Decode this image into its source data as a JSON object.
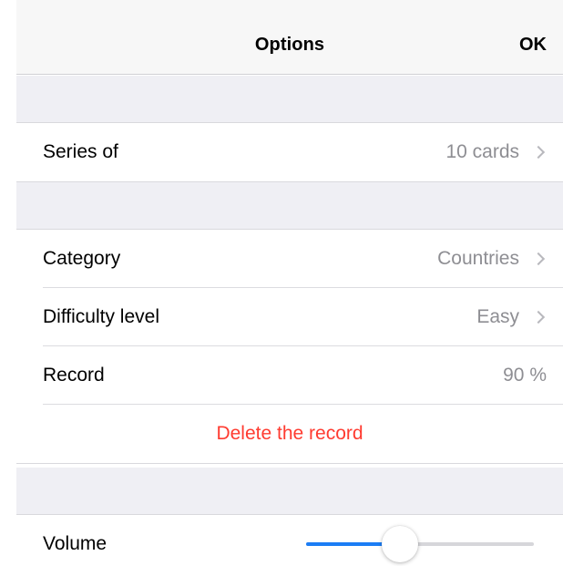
{
  "navbar": {
    "title": "Options",
    "ok_label": "OK"
  },
  "series": {
    "label": "Series of",
    "value": "10 cards"
  },
  "game": {
    "category": {
      "label": "Category",
      "value": "Countries"
    },
    "difficulty": {
      "label": "Difficulty level",
      "value": "Easy"
    },
    "record": {
      "label": "Record",
      "value": "90 %"
    },
    "delete_label": "Delete the record"
  },
  "sound": {
    "volume_label": "Volume",
    "volume_level": 0.41
  },
  "colors": {
    "accent": "#1b7df5",
    "destructive": "#ff3b30",
    "secondary_text": "#8e8e93",
    "grouped_background": "#efeff4"
  }
}
